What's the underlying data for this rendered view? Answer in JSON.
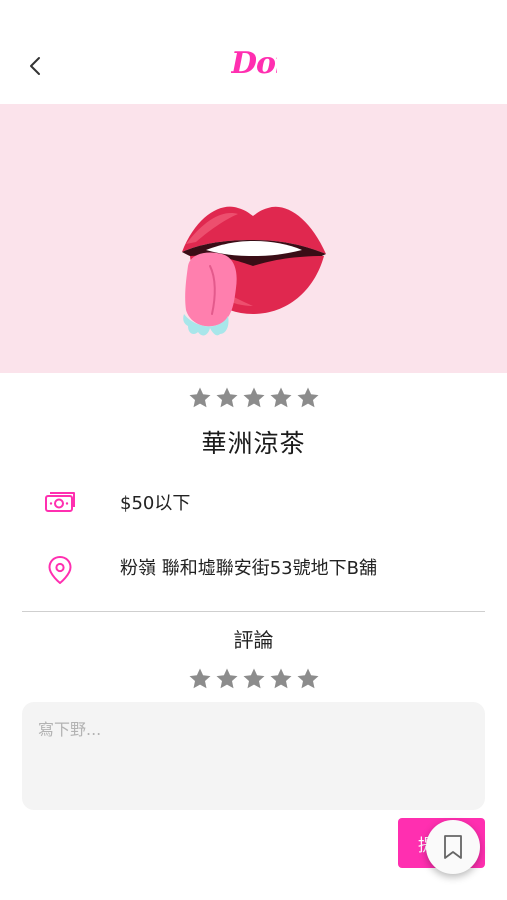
{
  "header": {
    "logo_text": "Doi"
  },
  "colors": {
    "brand_pink": "#ff2fb0",
    "hero_background": "#fbe3eb",
    "star_grey": "#8c8c8c"
  },
  "restaurant": {
    "name": "華洲涼茶",
    "rating": 0,
    "rating_max": 5,
    "price": "$50以下",
    "address": "粉嶺 聯和墟聯安街53號地下B舖"
  },
  "review": {
    "heading": "評論",
    "rating": 0,
    "rating_max": 5,
    "placeholder": "寫下野...",
    "submit_label": "提交"
  },
  "icons": {
    "back": "back-chevron-icon",
    "hero": "lips-tongue-illustration",
    "price": "cash-icon",
    "location": "location-pin-icon",
    "star": "star-icon",
    "bookmark": "bookmark-icon"
  }
}
